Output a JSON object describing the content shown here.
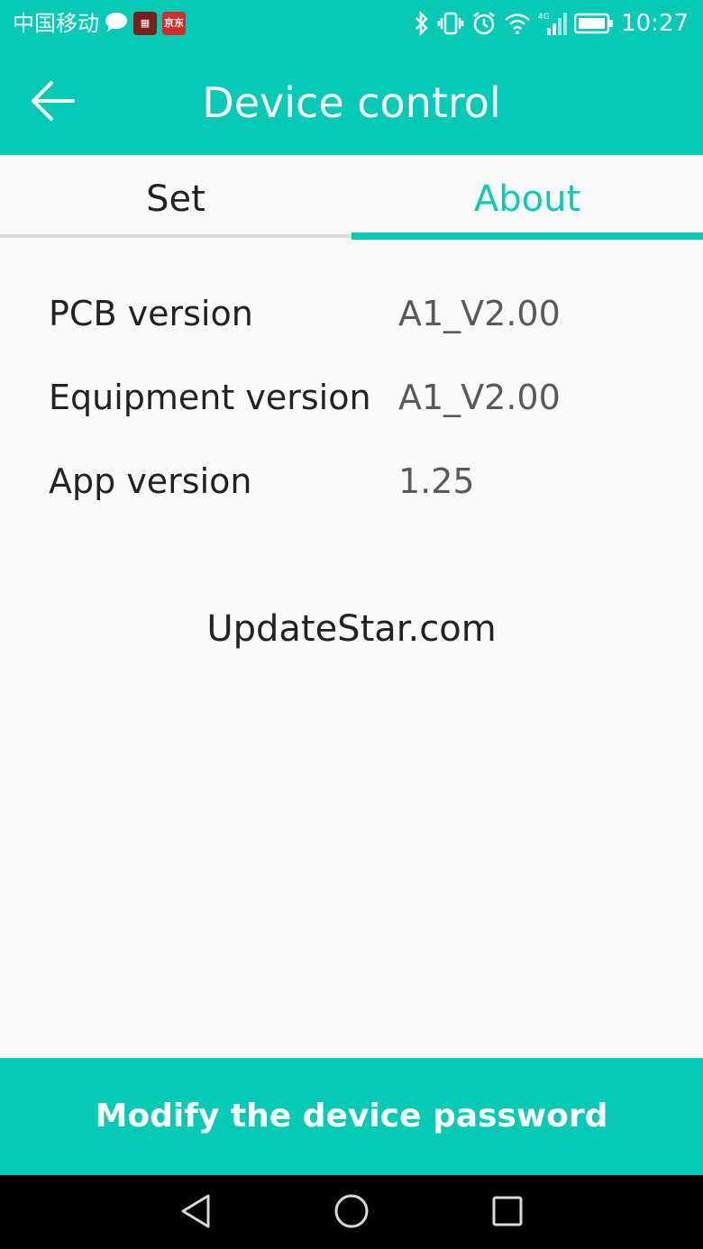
{
  "status_bar": {
    "carrier": "中国移动",
    "time": "10:27",
    "network": "4G",
    "app_icons": [
      {
        "name": "bubble-icon"
      },
      {
        "name": "app-badge-icon"
      },
      {
        "name": "jd-app-icon",
        "text": "京东"
      }
    ],
    "indicators": [
      "bluetooth-icon",
      "vibrate-icon",
      "alarm-icon",
      "wifi-icon",
      "cell-signal-icon",
      "battery-icon"
    ]
  },
  "app_bar": {
    "title": "Device control",
    "back_icon": "arrow-left-icon"
  },
  "tabs": [
    {
      "label": "Set",
      "active": false
    },
    {
      "label": "About",
      "active": true
    }
  ],
  "about": {
    "rows": [
      {
        "label": "PCB version",
        "value": "A1_V2.00"
      },
      {
        "label": "Equipment version",
        "value": "A1_V2.00"
      },
      {
        "label": "App version",
        "value": "1.25"
      }
    ]
  },
  "watermark": "UpdateStar.com",
  "primary_button": {
    "label": "Modify the device password"
  },
  "nav_bar": {
    "buttons": [
      "back-triangle-icon",
      "home-circle-icon",
      "recents-square-icon"
    ]
  },
  "colors": {
    "accent": "#06c9b6",
    "accent_text": "#10c8b4",
    "background": "#fafafa",
    "nav_bar": "#000000"
  }
}
